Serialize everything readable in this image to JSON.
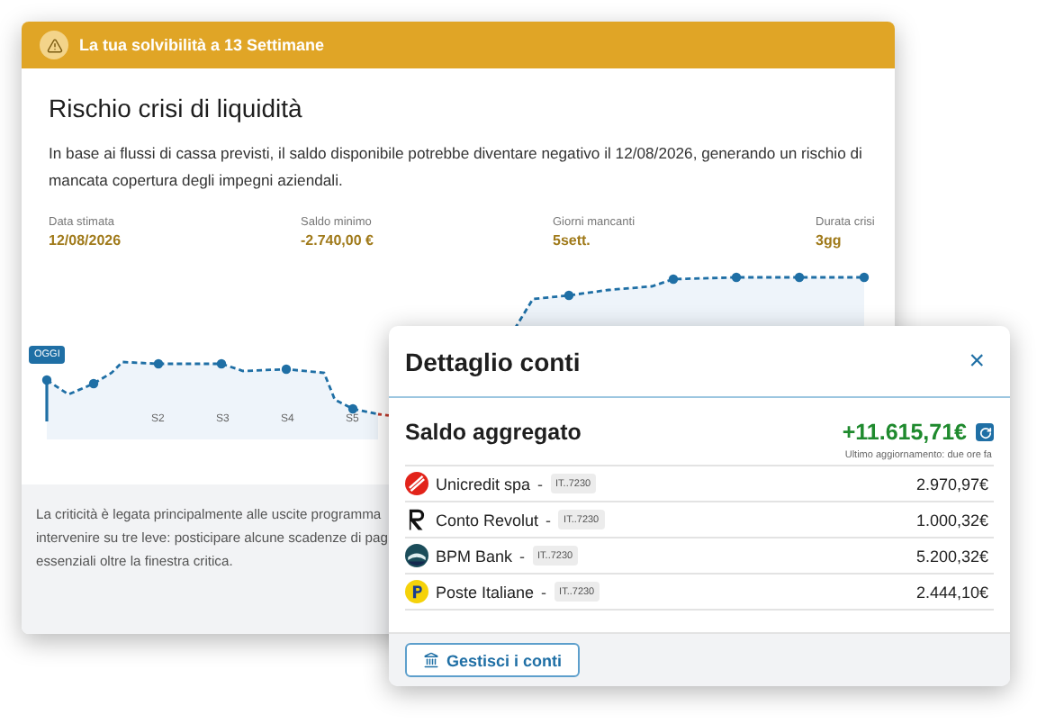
{
  "banner": {
    "title": "La tua solvibilità a 13 Settimane"
  },
  "risk": {
    "title": "Rischio crisi di liquidità",
    "description": "In base ai flussi di cassa previsti, il saldo disponibile potrebbe diventare negativo il 12/08/2026, generando un rischio di mancata copertura degli impegni aziendali."
  },
  "stats": [
    {
      "label": "Data stimata",
      "value": "12/08/2026"
    },
    {
      "label": "Saldo minimo",
      "value": "-2.740,00 €"
    },
    {
      "label": "Giorni mancanti",
      "value": "5sett."
    },
    {
      "label": "Durata crisi",
      "value": "3gg"
    }
  ],
  "chart": {
    "today_label": "OGGI",
    "week_labels": [
      "S2",
      "S3",
      "S4",
      "S5"
    ]
  },
  "note": {
    "lines": [
      "La criticità è legata principalmente alle uscite programma",
      "intervenire su tre leve: posticipare alcune scadenze di pag",
      "essenziali oltre la finestra critica."
    ]
  },
  "accounts_panel": {
    "title": "Dettaglio conti",
    "close": "×",
    "aggregate_label": "Saldo aggregato",
    "aggregate_value": "+11.615,71€",
    "updated": "Ultimo aggiornamento: due ore fa",
    "accounts": [
      {
        "name": "Unicredit spa",
        "kind": "unicredit",
        "separator": "-",
        "iban": "IT..7230",
        "balance": "2.970,97€"
      },
      {
        "name": "Conto Revolut",
        "kind": "revolut",
        "separator": "-",
        "iban": "IT..7230",
        "balance": "1.000,32€"
      },
      {
        "name": "BPM Bank",
        "kind": "bpm",
        "separator": "-",
        "iban": "IT..7230",
        "balance": "5.200,32€"
      },
      {
        "name": "Poste Italiane",
        "kind": "poste",
        "separator": "-",
        "iban": "IT..7230",
        "balance": "2.444,10€"
      }
    ],
    "button": "Gestisci i conti"
  }
}
